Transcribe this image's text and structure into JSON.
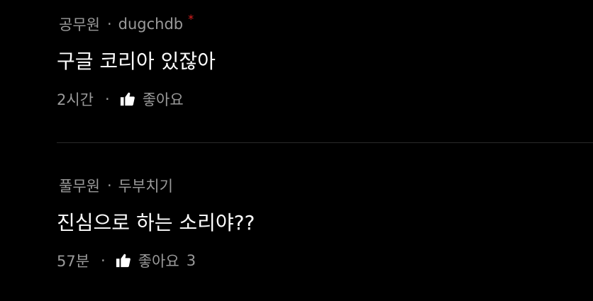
{
  "comments": [
    {
      "rank": "공무원",
      "author": "dugchdb",
      "author_marker": "*",
      "text": "구글 코리아 있잖아",
      "time": "2시간",
      "like_label": "좋아요",
      "like_count": ""
    },
    {
      "rank": "풀무원",
      "author": "두부치기",
      "author_marker": "",
      "text": "진심으로 하는 소리야??",
      "time": "57분",
      "like_label": "좋아요",
      "like_count": "3"
    }
  ],
  "separator": "·",
  "icons": {
    "like": "thumbs-up-icon"
  },
  "colors": {
    "background": "#000000",
    "text": "#ffffff",
    "muted": "#9a9a9a",
    "marker": "#e02020",
    "divider": "#2a2a2a"
  }
}
